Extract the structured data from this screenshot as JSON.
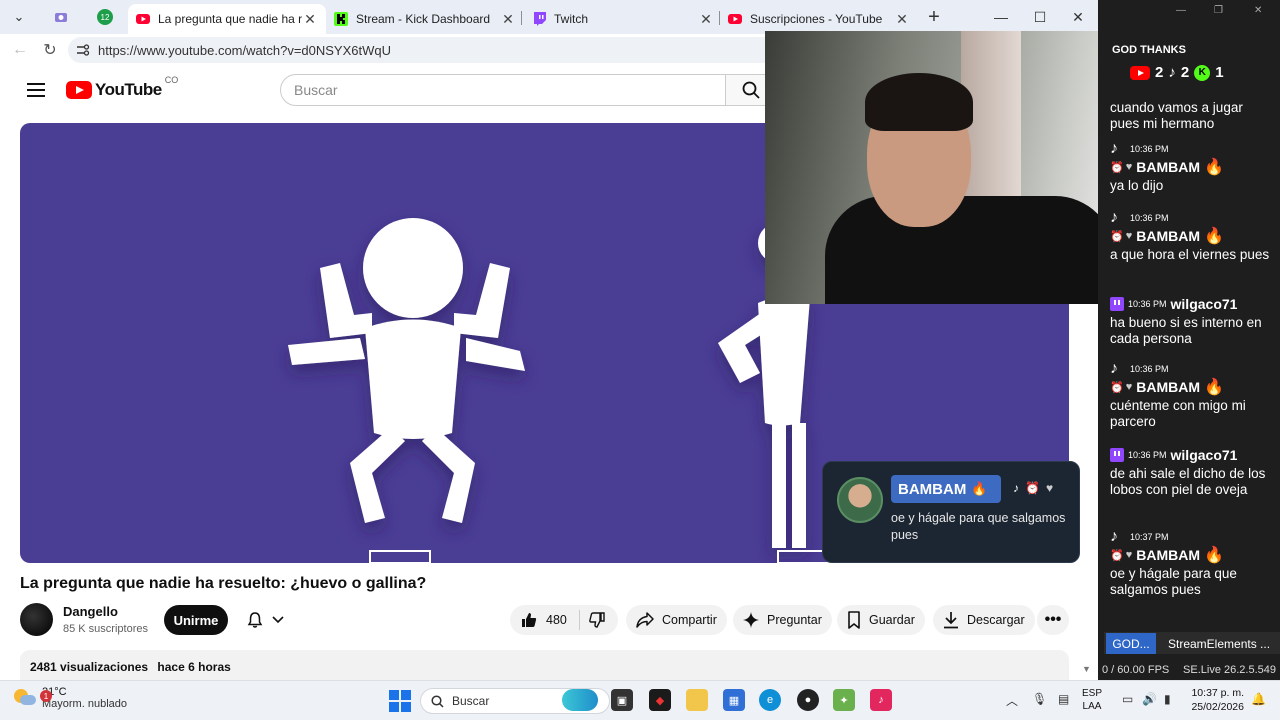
{
  "browser": {
    "pinned_tabs": [
      "",
      "12"
    ],
    "tabs": [
      {
        "title": "La pregunta que nadie ha resuelto",
        "active": true,
        "favicon": "youtube-icon"
      },
      {
        "title": "Stream - Kick Dashboard",
        "active": false,
        "favicon": "kick-icon"
      },
      {
        "title": "Twitch",
        "active": false,
        "favicon": "twitch-icon"
      },
      {
        "title": "Suscripciones - YouTube",
        "active": false,
        "favicon": "youtube-icon"
      }
    ],
    "url": "https://www.youtube.com/watch?v=d0NSYX6tWqU"
  },
  "youtube": {
    "logo_text": "YouTube",
    "logo_country": "CO",
    "search_placeholder": "Buscar",
    "video_title": "La pregunta que nadie ha resuelto: ¿huevo o gallina?",
    "channel_name": "Dangello",
    "channel_subs": "85 K suscriptores",
    "join_label": "Unirme",
    "like_count": "480",
    "share_label": "Compartir",
    "ask_label": "Preguntar",
    "save_label": "Guardar",
    "download_label": "Descargar",
    "views": "2481 visualizaciones",
    "age": "hace 6 horas"
  },
  "chat": {
    "header": "GOD THANKS",
    "counts": {
      "youtube": "2",
      "tiktok": "2",
      "kick": "1"
    },
    "messages": [
      {
        "platform": "tiktok",
        "time": "10:36 PM",
        "user": "BAMBAM",
        "text": "ya lo dijo"
      },
      {
        "platform": "tiktok",
        "time": "10:36 PM",
        "user": "BAMBAM",
        "text": "a que hora el viernes pues"
      },
      {
        "platform": "twitch",
        "time": "10:36 PM",
        "user": "wilgaco71",
        "text": "ha bueno si es interno en cada persona"
      },
      {
        "platform": "tiktok",
        "time": "10:36 PM",
        "user": "BAMBAM",
        "text": "cuénteme con migo mi parcero"
      },
      {
        "platform": "twitch",
        "time": "10:36 PM",
        "user": "wilgaco71",
        "text": "de ahi sale el dicho de los lobos con piel de oveja"
      },
      {
        "platform": "tiktok",
        "time": "10:37 PM",
        "user": "BAMBAM",
        "text": "oe y hágale para que salgamos pues"
      }
    ],
    "partial_top_text": "cuando vamos a jugar pues mi hermano",
    "tab_god": "GOD...",
    "tab_se": "StreamElements ...",
    "fps": "0 / 60.00 FPS",
    "version": "SE.Live 26.2.5.549"
  },
  "notification": {
    "user": "BAMBAM",
    "text": "oe y hágale para que salgamos pues"
  },
  "taskbar": {
    "weather_temp": "21°C",
    "weather_desc": "Mayorm. nublado",
    "weather_badge": "1",
    "search_placeholder": "Buscar",
    "lang_1": "ESP",
    "lang_2": "LAA",
    "time": "10:37 p. m.",
    "date": "25/02/2026"
  }
}
